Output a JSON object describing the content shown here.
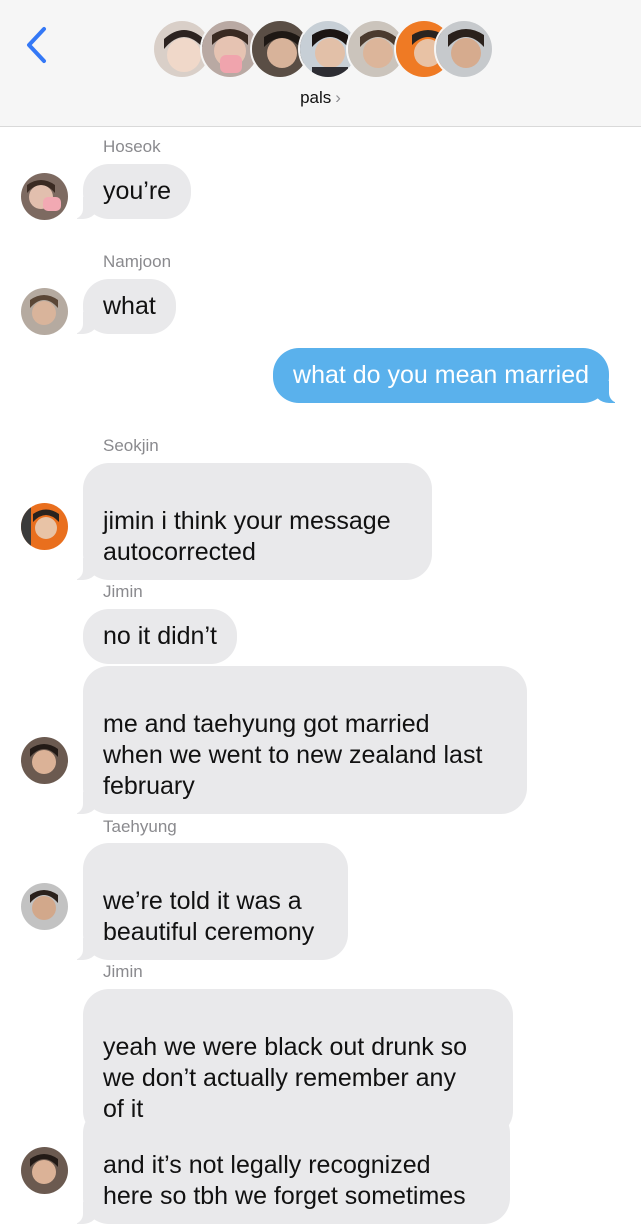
{
  "header": {
    "group_name": "pals",
    "chevron": "›",
    "back_icon": "chevron-left-icon",
    "accent": "#3478f6"
  },
  "messages": [
    {
      "sender": "Hoseok",
      "text": "you’re"
    },
    {
      "sender": "Namjoon",
      "text": "what"
    },
    {
      "outgoing": true,
      "text": "what do you mean married"
    },
    {
      "sender": "Seokjin",
      "text": "jimin i think your message\nautocorrected"
    },
    {
      "sender": "Jimin",
      "text": "no it didn’t"
    },
    {
      "text": "me and taehyung got married\nwhen we went to new zealand last\nfebruary"
    },
    {
      "sender": "Taehyung",
      "text": "we’re told it was a\nbeautiful ceremony"
    },
    {
      "sender": "Jimin",
      "text": "yeah we were black out drunk so\nwe don’t actually remember any\nof it"
    },
    {
      "text": "and it’s not legally recognized\nhere so tbh we forget sometimes"
    }
  ],
  "colors": {
    "incoming_bubble": "#e9e9eb",
    "outgoing_bubble": "#5ab1ec",
    "sender_label": "#8a8a8e"
  }
}
